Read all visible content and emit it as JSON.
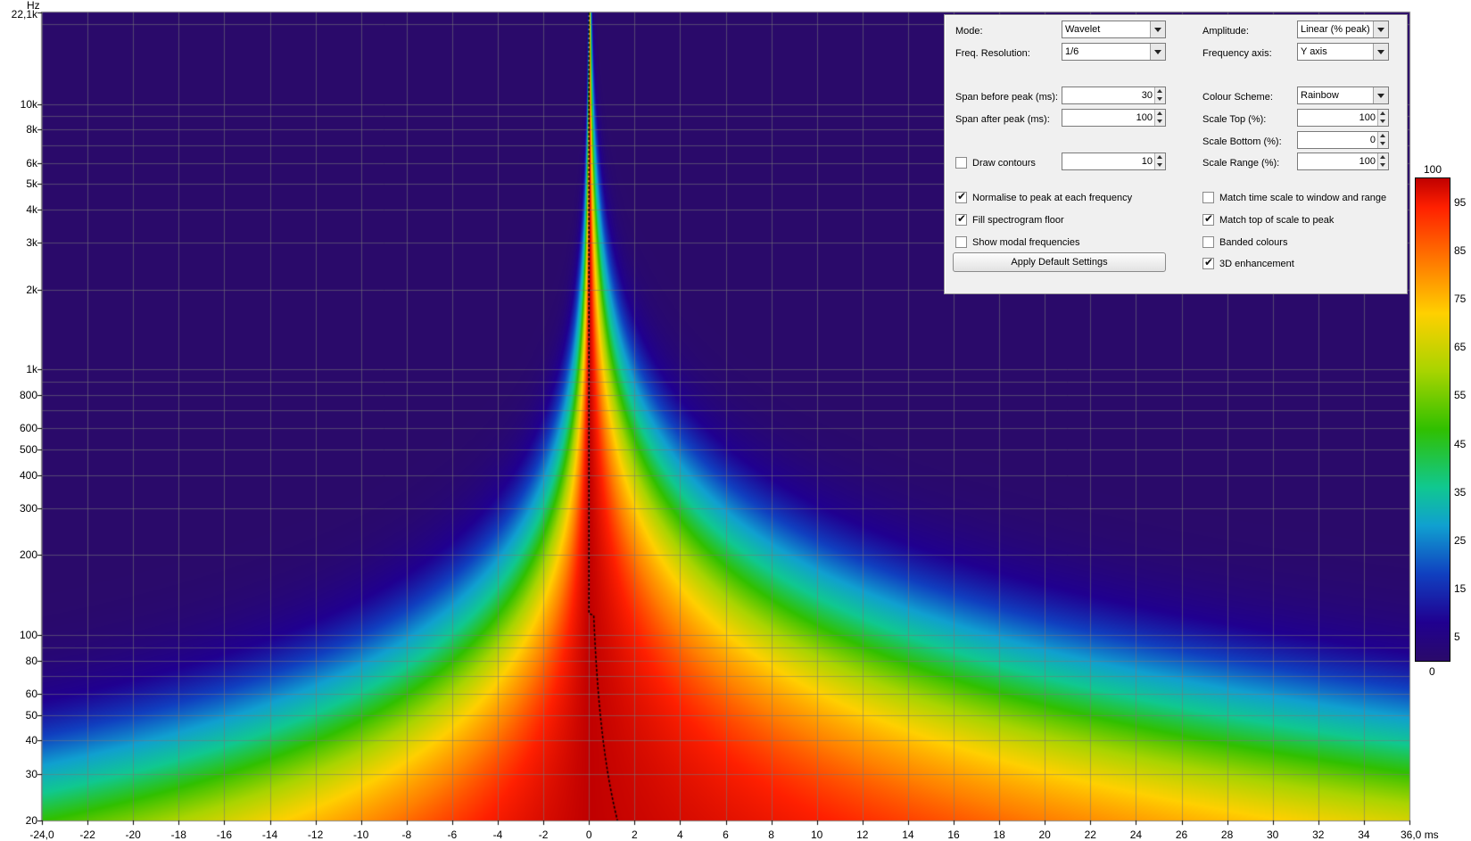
{
  "axes": {
    "y_unit": "Hz",
    "y_tick_labels": [
      "22,1k",
      "10k",
      "8k",
      "6k",
      "5k",
      "4k",
      "3k",
      "2k",
      "1k",
      "800",
      "600",
      "500",
      "400",
      "300",
      "200",
      "100",
      "80",
      "60",
      "50",
      "40",
      "30",
      "20"
    ],
    "x_tick_labels": [
      "-24,0",
      "-22",
      "-20",
      "-18",
      "-16",
      "-14",
      "-12",
      "-10",
      "-8",
      "-6",
      "-4",
      "-2",
      "0",
      "2",
      "4",
      "6",
      "8",
      "10",
      "12",
      "14",
      "16",
      "18",
      "20",
      "22",
      "24",
      "26",
      "28",
      "30",
      "32",
      "34",
      "36,0 ms"
    ]
  },
  "chart_data": {
    "type": "heatmap",
    "title": "",
    "xlabel": "ms",
    "ylabel": "Hz",
    "xlim": [
      -24,
      36
    ],
    "ylim": [
      20,
      22100
    ],
    "y_scale": "log",
    "x_ticks": [
      -24,
      -22,
      -20,
      -18,
      -16,
      -14,
      -12,
      -10,
      -8,
      -6,
      -4,
      -2,
      0,
      2,
      4,
      6,
      8,
      10,
      12,
      14,
      16,
      18,
      20,
      22,
      24,
      26,
      28,
      30,
      32,
      34,
      36
    ],
    "y_ticks": [
      20,
      30,
      40,
      50,
      60,
      80,
      100,
      200,
      300,
      400,
      500,
      600,
      800,
      1000,
      2000,
      3000,
      4000,
      5000,
      6000,
      8000,
      10000,
      22100
    ],
    "value_range": [
      0,
      100
    ],
    "colour_scale": [
      "#2a0a6a",
      "#200090",
      "#1040c0",
      "#10a0d0",
      "#10c890",
      "#30c000",
      "#a8d400",
      "#ffd000",
      "#ff8000",
      "#ff2000",
      "#c00000"
    ],
    "peak_time_ms": 0,
    "grid": true
  },
  "colorbar": {
    "labels": [
      "100",
      "95",
      "85",
      "75",
      "65",
      "55",
      "45",
      "35",
      "25",
      "15",
      "5",
      "0"
    ]
  },
  "panel": {
    "mode_label": "Mode:",
    "mode_value": "Wavelet",
    "freq_res_label": "Freq. Resolution:",
    "freq_res_value": "1/6",
    "span_before_label": "Span before peak (ms):",
    "span_before_value": "30",
    "span_after_label": "Span after peak (ms):",
    "span_after_value": "100",
    "draw_contours_label": "Draw contours",
    "draw_contours_value": "10",
    "normalise_label": "Normalise to peak at each frequency",
    "fill_floor_label": "Fill spectrogram floor",
    "show_modal_label": "Show modal frequencies",
    "apply_default_label": "Apply Default Settings",
    "amplitude_label": "Amplitude:",
    "amplitude_value": "Linear (% peak)",
    "freq_axis_label": "Frequency axis:",
    "freq_axis_value": "Y axis",
    "colour_scheme_label": "Colour Scheme:",
    "colour_scheme_value": "Rainbow",
    "scale_top_label": "Scale Top (%):",
    "scale_top_value": "100",
    "scale_bottom_label": "Scale Bottom (%):",
    "scale_bottom_value": "0",
    "scale_range_label": "Scale Range (%):",
    "scale_range_value": "100",
    "match_time_label": "Match time scale to window and range",
    "match_top_label": "Match top of scale to peak",
    "banded_label": "Banded colours",
    "enhance_label": "3D enhancement"
  }
}
